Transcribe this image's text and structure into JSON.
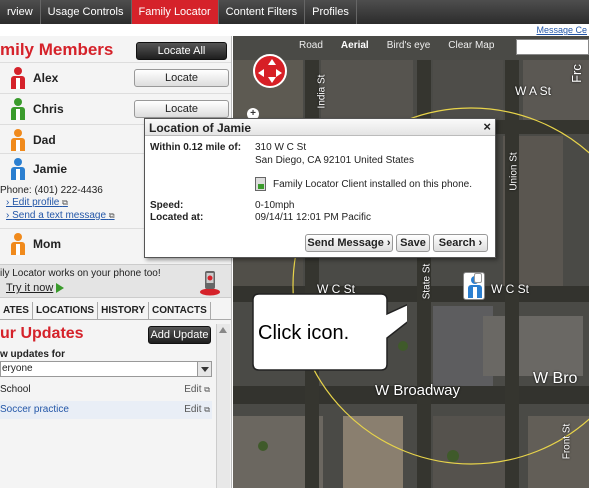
{
  "nav": {
    "tabs": [
      "rview",
      "Usage Controls",
      "Family Locator",
      "Content Filters",
      "Profiles"
    ],
    "active_tab": "Family Locator",
    "message_center": "Message Ce"
  },
  "sidebar": {
    "title": "mily Members",
    "locate_all": "Locate All",
    "members": [
      {
        "name": "Alex",
        "button": "Locate",
        "color": "#d5222a"
      },
      {
        "name": "Chris",
        "button": "Locate",
        "color": "#3a9b2c"
      },
      {
        "name": "Dad",
        "button": "",
        "color": "#f08a1c"
      },
      {
        "name": "Jamie",
        "button": "",
        "color": "#2b7fd0"
      },
      {
        "name": "Mom",
        "button": "",
        "color": "#f08a1c"
      }
    ],
    "jamie_detail": {
      "phone": "Phone: (401) 222-4436",
      "edit_profile": "Edit profile",
      "send_text": "Send a text message"
    },
    "promo": {
      "text": "ily Locator works on your phone too!",
      "link": "Try it now"
    },
    "subtabs": [
      "ATES",
      "LOCATIONS",
      "HISTORY",
      "CONTACTS"
    ],
    "updates": {
      "title": "ur Updates",
      "add_button": "Add Update",
      "show_for_label": "w updates for",
      "select_value": "eryone",
      "rows": [
        {
          "name": "School",
          "edit": "Edit"
        },
        {
          "name": "Soccer practice",
          "edit": "Edit"
        }
      ]
    }
  },
  "map": {
    "types": [
      "Road",
      "Aerial",
      "Bird's eye",
      "Clear Map"
    ],
    "selected_type": "Aerial",
    "street_labels": {
      "wc_left": "W C St",
      "wc_right": "W C St",
      "wa": "W A St",
      "w_broadway": "W Broadway",
      "w_bro": "W Bro",
      "india": "India St",
      "union": "Union St",
      "front": "Front St",
      "state": "State St",
      "frc": "Frc"
    },
    "popup": {
      "title": "Location of Jamie",
      "close": "×",
      "within_label": "Within 0.12 mile of:",
      "address_line1": "310 W C St",
      "address_line2": "San Diego, CA 92101 United States",
      "client_note": "Family Locator Client installed on this phone.",
      "speed_label": "Speed:",
      "speed_value": "0-10mph",
      "located_label": "Located at:",
      "located_value": "09/14/11 12:01 PM Pacific",
      "buttons": [
        "Send Message ›",
        "Save",
        "Search ›"
      ]
    },
    "callout_text": "Click icon."
  }
}
